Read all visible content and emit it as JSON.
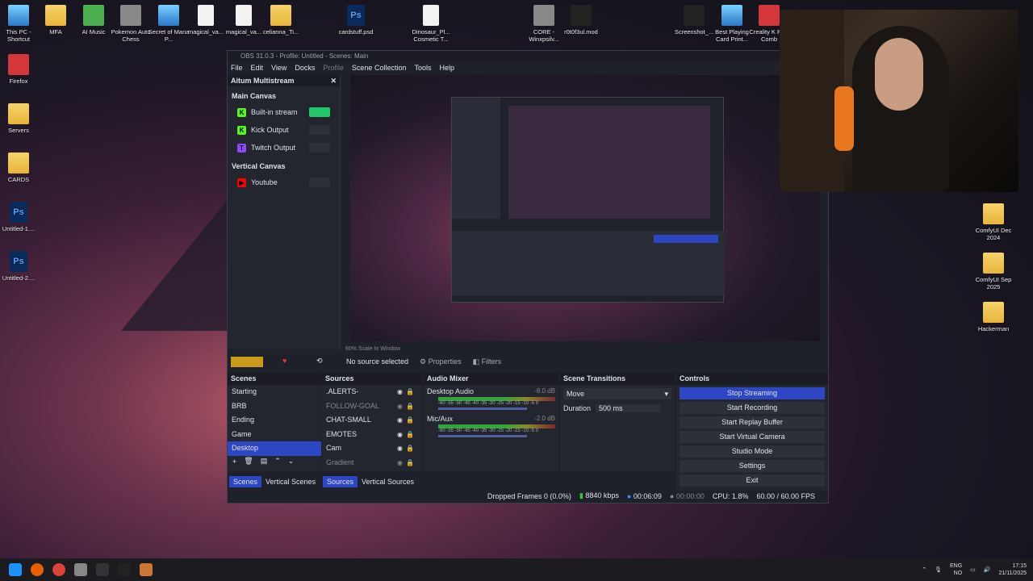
{
  "desktop": {
    "left_icons": [
      {
        "label": "This PC - Shortcut",
        "type": "app"
      },
      {
        "label": "Firefox",
        "type": "red"
      },
      {
        "label": "Servers",
        "type": "folder"
      },
      {
        "label": "CARDS",
        "type": "folder"
      },
      {
        "label": "Untitled-1....",
        "type": "ps"
      },
      {
        "label": "Untitled-2....",
        "type": "ps"
      }
    ],
    "top_icons": [
      {
        "label": "MFA",
        "type": "folder"
      },
      {
        "label": "AI Music",
        "type": "green"
      },
      {
        "label": "Pokemon Auto Chess",
        "type": "gray"
      },
      {
        "label": "Secret of Mana P...",
        "type": "app"
      },
      {
        "label": "magical_va...",
        "type": "doc"
      },
      {
        "label": "magical_va...",
        "type": "doc"
      },
      {
        "label": "celianna_Ti...",
        "type": "folder"
      },
      {
        "label": "cardstuff.psd",
        "type": "ps"
      },
      {
        "label": "Dinosaur_Pl... Cosmetic T...",
        "type": "doc"
      },
      {
        "label": "CORE - Winxpsilv...",
        "type": "gray"
      },
      {
        "label": "r0t0f3ul.mod",
        "type": "black"
      },
      {
        "label": "Screenshot_...",
        "type": "black"
      },
      {
        "label": "Best Playing Card Print...",
        "type": "app"
      },
      {
        "label": "Creality K Plus Comb",
        "type": "red"
      }
    ],
    "right_icons": [
      {
        "label": "ComfyUI Dec 2024",
        "type": "folder"
      },
      {
        "label": "ComfyUI Sep 2025",
        "type": "folder"
      },
      {
        "label": "Hackerman",
        "type": "folder"
      }
    ]
  },
  "obs": {
    "title": "OBS 31.0.3 - Profile: Untitled - Scenes: Main",
    "menu": [
      "File",
      "Edit",
      "View",
      "Docks",
      "Profile",
      "Scene Collection",
      "Tools",
      "Help"
    ],
    "dock": {
      "title": "Aitum Multistream",
      "main_canvas": "Main Canvas",
      "outputs": [
        {
          "label": "Built-in stream",
          "logo": "K",
          "color": "#53fc18",
          "on": true
        },
        {
          "label": "Kick Output",
          "logo": "K",
          "color": "#53fc18",
          "on": false
        },
        {
          "label": "Twitch Output",
          "logo": "T",
          "color": "#9146ff",
          "on": false
        }
      ],
      "vertical_canvas": "Vertical Canvas",
      "vertical_outputs": [
        {
          "label": "Youtube",
          "logo": "▶",
          "color": "#ff0000",
          "on": false
        }
      ]
    },
    "scale_label": "60%  Scale to Window",
    "no_source": "No source selected",
    "properties": "Properties",
    "filters": "Filters",
    "scenes": {
      "title": "Scenes",
      "items": [
        "Starting",
        "BRB",
        "Ending",
        "Game",
        "Desktop"
      ],
      "selected": 4
    },
    "sources": {
      "title": "Sources",
      "items": [
        {
          "label": ".ALERTS-",
          "dim": false
        },
        {
          "label": "FOLLOW-GOAL",
          "dim": true
        },
        {
          "label": "CHAT-SMALL",
          "dim": false
        },
        {
          "label": "EMOTES",
          "dim": false
        },
        {
          "label": "Cam",
          "dim": false
        },
        {
          "label": "Gradient",
          "dim": true
        }
      ]
    },
    "mixer": {
      "title": "Audio Mixer",
      "channels": [
        {
          "name": "Desktop Audio",
          "db": "-8.0 dB"
        },
        {
          "name": "Mic/Aux",
          "db": "-2.0 dB"
        }
      ],
      "ticks": "-60 -55 -50 -45 -40 -35 -30 -25 -20 -15 -10 -5 0"
    },
    "transitions": {
      "title": "Scene Transitions",
      "selected": "Move",
      "duration_label": "Duration",
      "duration": "500 ms"
    },
    "controls": {
      "title": "Controls",
      "buttons": [
        "Stop Streaming",
        "Start Recording",
        "Start Replay Buffer",
        "Start Virtual Camera",
        "Studio Mode",
        "Settings",
        "Exit"
      ]
    },
    "tabs": {
      "scenes": "Scenes",
      "vscenes": "Vertical Scenes",
      "sources": "Sources",
      "vsources": "Vertical Sources"
    },
    "status": {
      "dropped": "Dropped Frames 0 (0.0%)",
      "kbps": "8840 kbps",
      "live": "00:06:09",
      "rec": "00:00:00",
      "cpu": "CPU: 1.8%",
      "fps": "60.00 / 60.00 FPS"
    }
  },
  "taskbar": {
    "lang1": "ENG",
    "lang2": "NO",
    "time": "17:15",
    "date": "21/11/2025"
  },
  "colors": {
    "accent": "#2c46c4",
    "kick": "#53fc18"
  }
}
